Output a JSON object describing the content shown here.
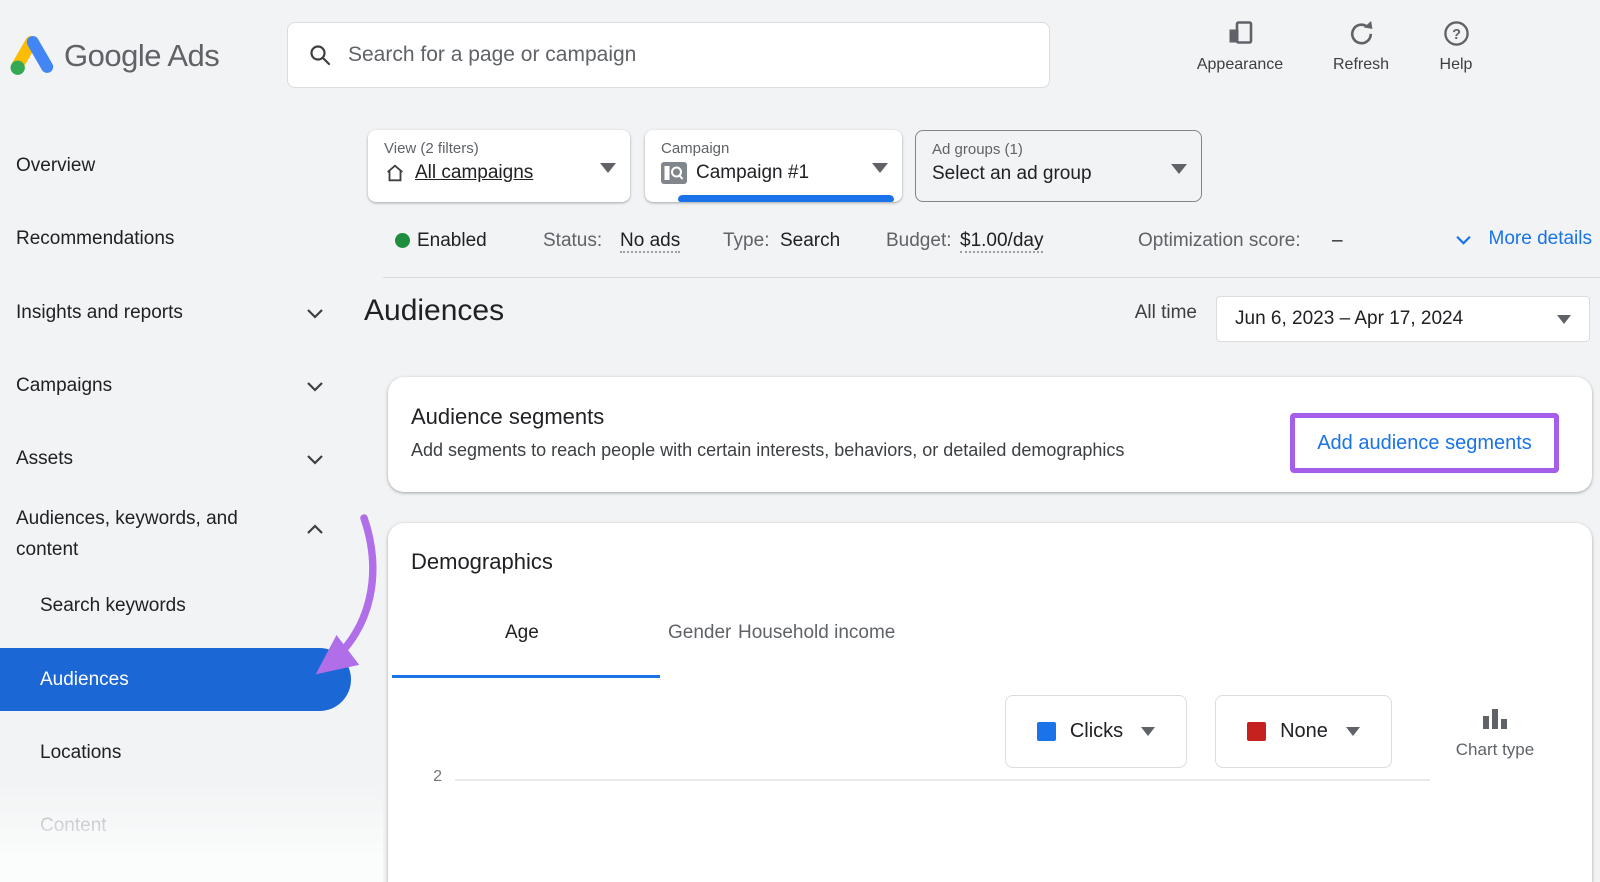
{
  "brand": {
    "name": "Google Ads"
  },
  "topbar": {
    "search_placeholder": "Search for a page or campaign",
    "appearance_label": "Appearance",
    "refresh_label": "Refresh",
    "help_label": "Help"
  },
  "sidebar": {
    "items": [
      {
        "label": "Overview"
      },
      {
        "label": "Recommendations"
      },
      {
        "label": "Insights and reports"
      },
      {
        "label": "Campaigns"
      },
      {
        "label": "Assets"
      },
      {
        "label": "Audiences, keywords, and content"
      },
      {
        "label": "Search keywords"
      },
      {
        "label": "Audiences",
        "selected": true
      },
      {
        "label": "Locations"
      },
      {
        "label": "Content",
        "disabled": true
      }
    ]
  },
  "filters": {
    "view": {
      "label": "View (2 filters)",
      "value": "All campaigns"
    },
    "campaign": {
      "label": "Campaign",
      "value": "Campaign #1"
    },
    "ad_groups": {
      "label": "Ad groups (1)",
      "value": "Select an ad group"
    }
  },
  "status": {
    "enabled": "Enabled",
    "status_label": "Status:",
    "status_value": "No ads",
    "type_label": "Type:",
    "type_value": "Search",
    "budget_label": "Budget:",
    "budget_value": "$1.00/day",
    "optimization_label": "Optimization score:",
    "optimization_value": "–",
    "more_details": "More details"
  },
  "page": {
    "title": "Audiences",
    "date_label": "All time",
    "date_range": "Jun 6, 2023 – Apr 17, 2024"
  },
  "audience_segments": {
    "title": "Audience segments",
    "description": "Add segments to reach people with certain interests, behaviors, or detailed demographics",
    "cta": "Add audience segments"
  },
  "demographics": {
    "title": "Demographics",
    "tabs": [
      "Age",
      "Gender",
      "Household income"
    ],
    "active_tab": "Age",
    "metric1": "Clicks",
    "metric2": "None",
    "chart_type": "Chart type",
    "y_tick": "2"
  },
  "colors": {
    "brand_blue": "#1a73e8",
    "selected_pill_blue": "#1b67d6",
    "enabled_green": "#1e8e3e",
    "metric_blue": "#1a73e8",
    "metric_red": "#c5221f",
    "annotation_purple": "#b06ee9"
  }
}
